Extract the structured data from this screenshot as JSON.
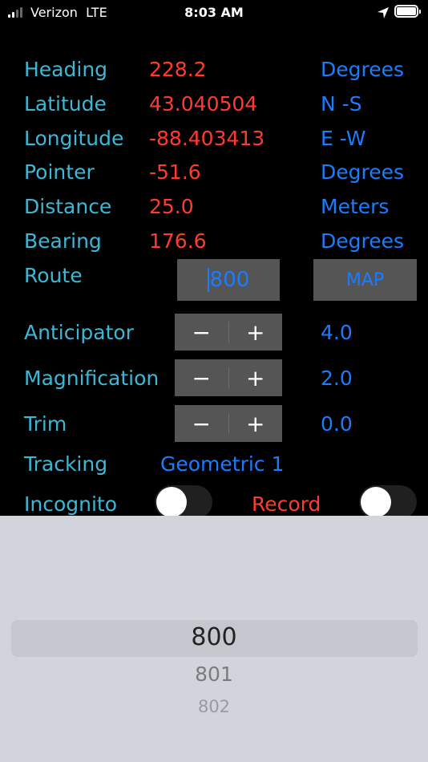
{
  "status_bar": {
    "carrier": "Verizon",
    "network": "LTE",
    "time": "8:03 AM"
  },
  "rows": [
    {
      "label": "Heading",
      "value": "228.2",
      "unit": "Degrees"
    },
    {
      "label": "Latitude",
      "value": "43.040504",
      "unit": "N -S"
    },
    {
      "label": "Longitude",
      "value": "-88.403413",
      "unit": "E -W"
    },
    {
      "label": "Pointer",
      "value": "-51.6",
      "unit": "Degrees"
    },
    {
      "label": "Distance",
      "value": "25.0",
      "unit": "Meters"
    },
    {
      "label": "Bearing",
      "value": "176.6",
      "unit": "Degrees"
    }
  ],
  "route": {
    "label": "Route",
    "value": "800",
    "map_label": "MAP"
  },
  "steppers": [
    {
      "label": "Anticipator",
      "minus": "−",
      "plus": "+",
      "value": "4.0"
    },
    {
      "label": "Magnification",
      "minus": "−",
      "plus": "+",
      "value": "2.0"
    },
    {
      "label": "Trim",
      "minus": "−",
      "plus": "+",
      "value": "0.0"
    }
  ],
  "tracking": {
    "label": "Tracking",
    "value": "Geometric 1"
  },
  "incognito": {
    "label": "Incognito",
    "on": false
  },
  "record": {
    "label": "Record",
    "on": false
  },
  "picker": {
    "selected": "800",
    "next1": "801",
    "next2": "802"
  },
  "colors": {
    "label": "#3cb8d6",
    "value": "#ff3b30",
    "accent": "#1a7cff",
    "control_bg": "#555555",
    "picker_bg": "#d1d4da"
  }
}
